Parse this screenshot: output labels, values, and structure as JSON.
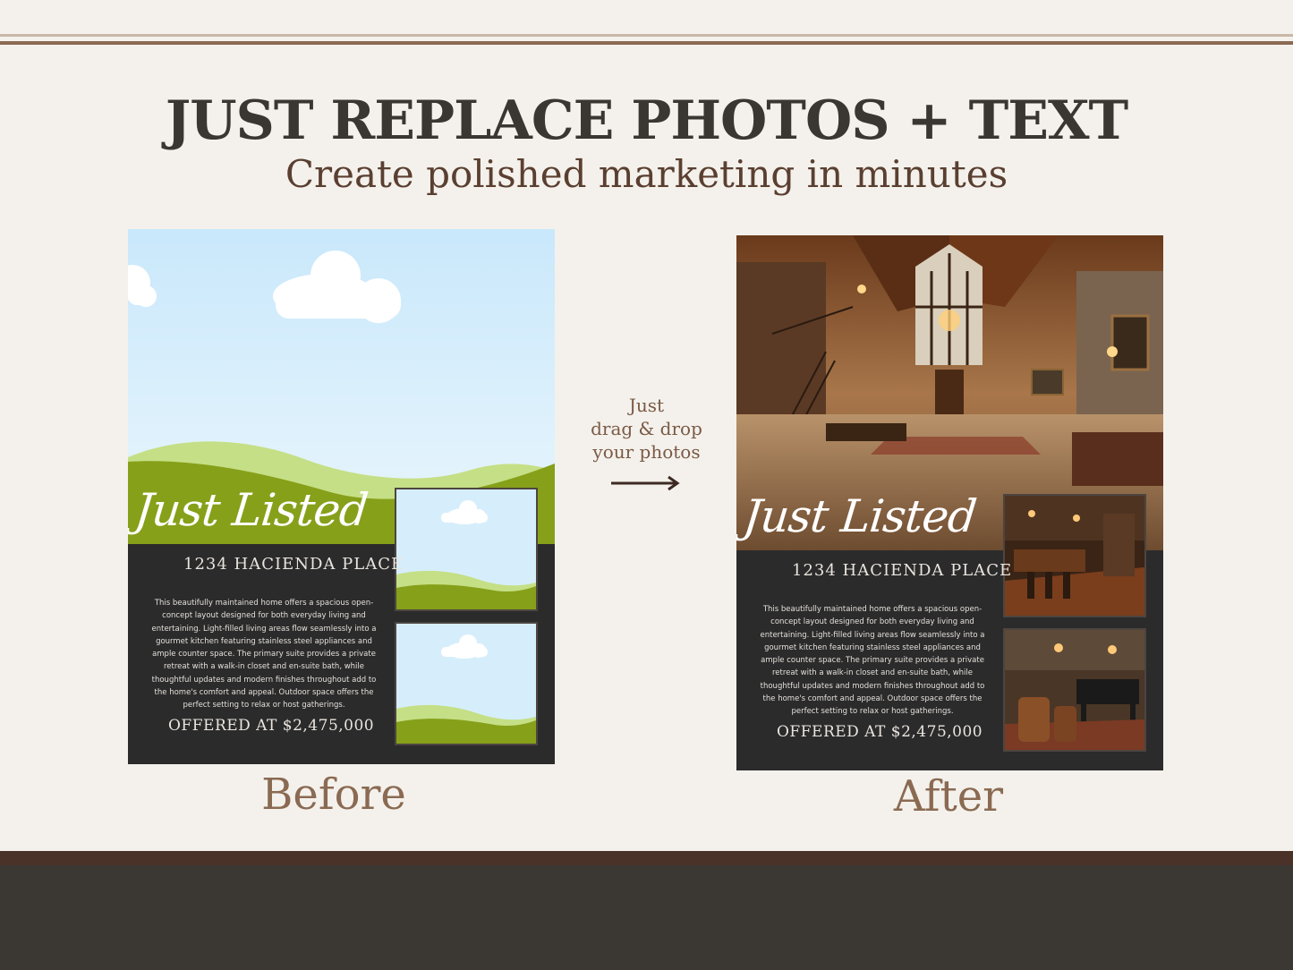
{
  "header": {
    "title": "JUST REPLACE PHOTOS + TEXT",
    "subtitle": "Create polished marketing in minutes"
  },
  "flyer": {
    "script_title": "Just Listed",
    "address": "1234 HACIENDA PLACE",
    "description": "This beautifully maintained home offers a spacious open-concept layout designed for both everyday living and entertaining. Light-filled living areas flow seamlessly into a gourmet kitchen featuring stainless steel appliances and ample counter space. The primary suite provides a private retreat with a walk-in closet and en-suite bath, while thoughtful updates and modern finishes throughout add to the home's comfort and appeal. Outdoor space offers the perfect setting to relax or host gatherings.",
    "price": "OFFERED AT $2,475,000"
  },
  "middle": {
    "line1": "Just",
    "line2": "drag & drop",
    "line3": "your photos",
    "arrow_icon": "right-arrow-icon"
  },
  "labels": {
    "before": "Before",
    "after": "After"
  },
  "colors": {
    "background": "#f4f1ec",
    "headline": "#3a3733",
    "accent_brown": "#8a6a52",
    "flyer_dark": "#2b2b2b",
    "footer": "#3b3834"
  }
}
